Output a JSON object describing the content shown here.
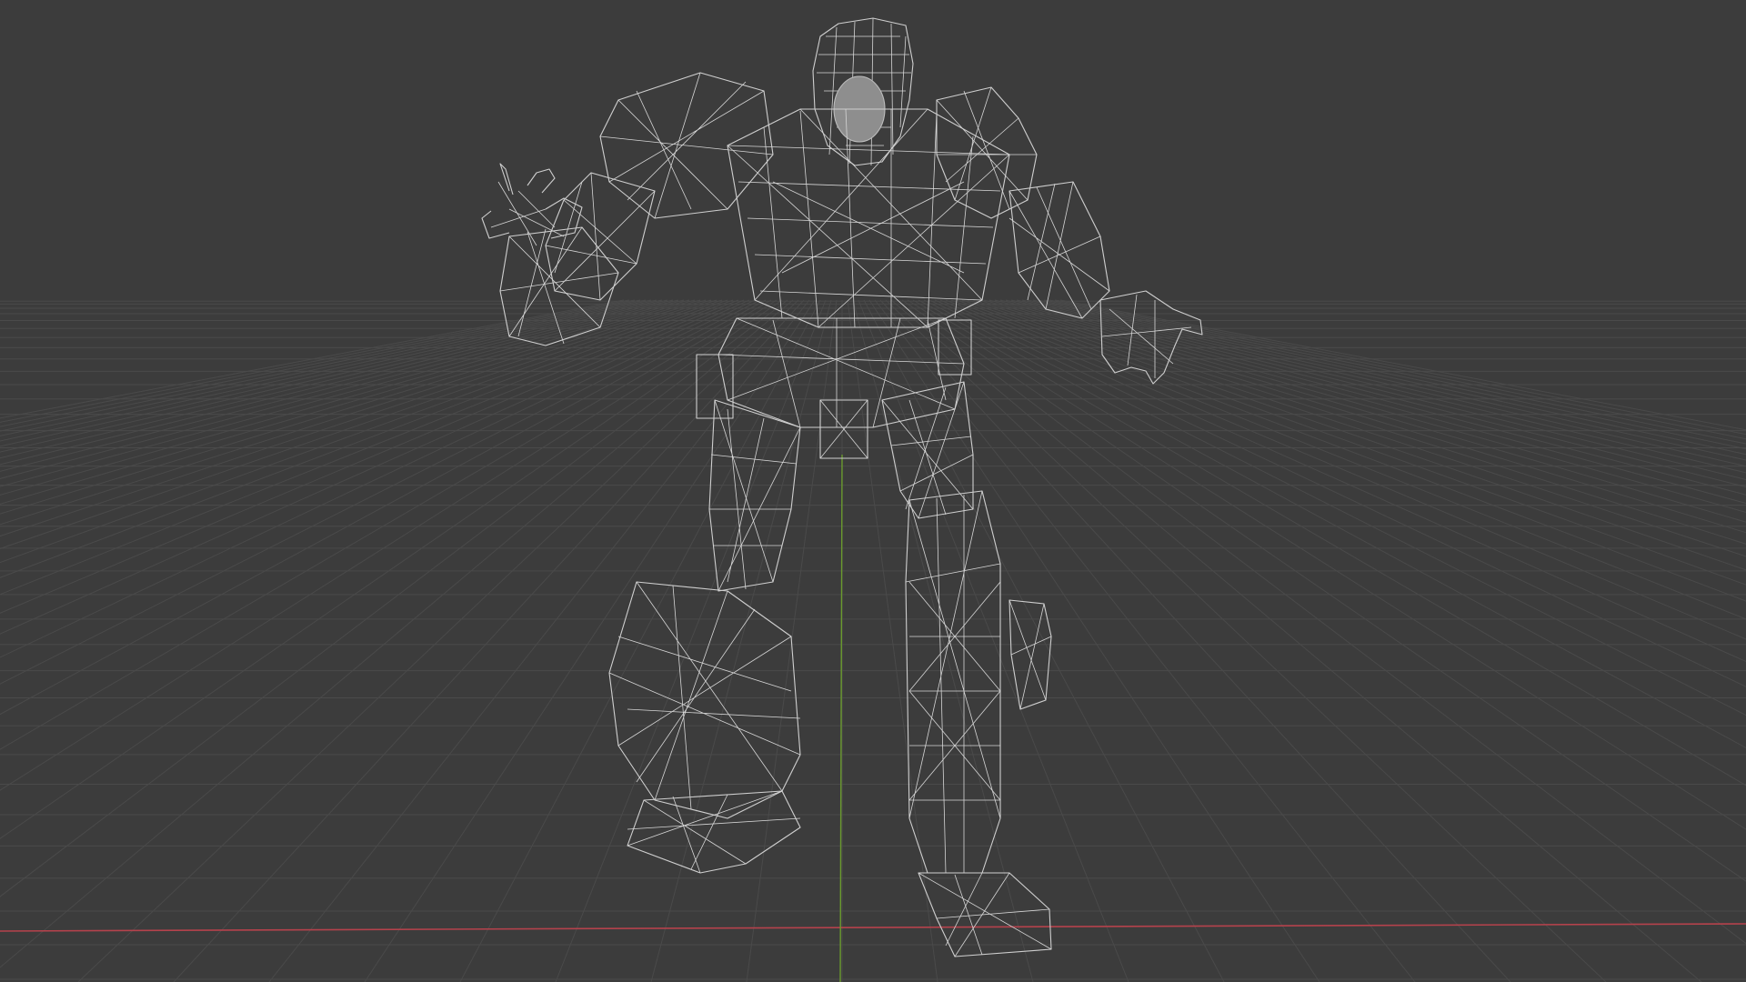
{
  "viewport": {
    "shading_mode": "wireframe",
    "background_color": "#3c3c3c",
    "grid_color": "#4a4a4a",
    "x_axis_color": "#b5424c",
    "y_axis_color": "#6a9a2e",
    "wire_color": "#cfcfcf"
  },
  "object": {
    "type": "robot-mesh"
  }
}
